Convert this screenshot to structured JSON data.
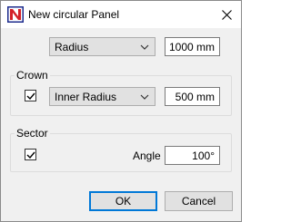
{
  "window": {
    "title": "New circular Panel",
    "app_icon": "app-logo-icon",
    "close_icon": "close-icon"
  },
  "top": {
    "shape_select": "Radius",
    "radius_value": "1000 mm"
  },
  "crown": {
    "title": "Crown",
    "checked": true,
    "select": "Inner Radius",
    "value": "500 mm"
  },
  "sector": {
    "title": "Sector",
    "checked": true,
    "angle_label": "Angle",
    "angle_value": "100°"
  },
  "buttons": {
    "ok": "OK",
    "cancel": "Cancel"
  },
  "colors": {
    "accent": "#0078d7",
    "logo_red": "#d42027",
    "logo_blue": "#1b2a8c"
  }
}
